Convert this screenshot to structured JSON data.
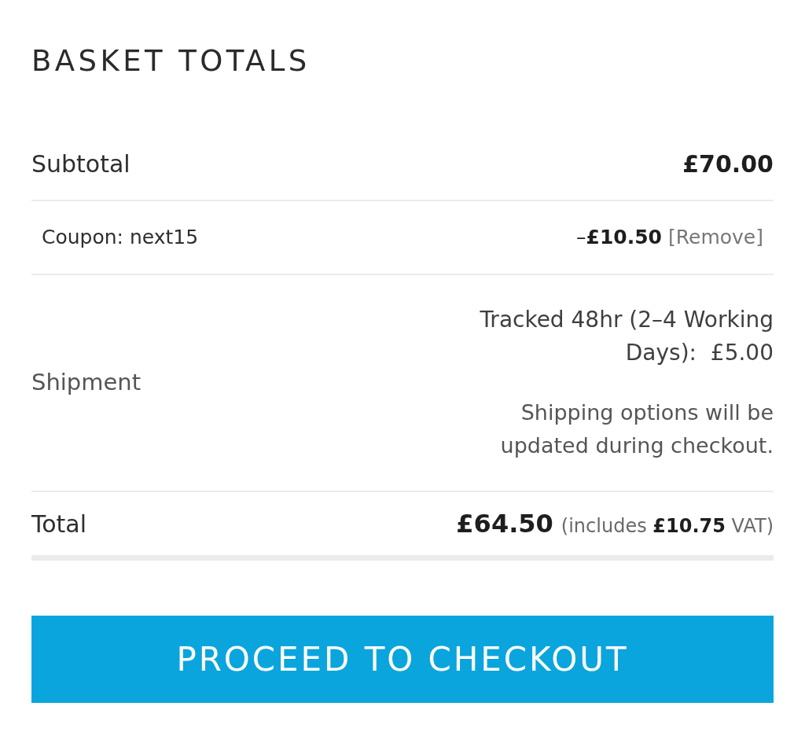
{
  "title": "BASKET TOTALS",
  "rows": [
    {
      "kind": "subtotal",
      "label": "Subtotal",
      "amount": "£70.00"
    },
    {
      "kind": "coupon",
      "label": "Coupon: next15",
      "amount": "–**£10.50**",
      "link": "[Remove]"
    },
    {
      "kind": "shipping",
      "label": "Shipment",
      "method": "Tracked 48hr (2–4 Working Days):  £5.00",
      "note": "Shipping options will be updated during checkout."
    },
    {
      "kind": "total",
      "label": "Total",
      "amount": "£64.50",
      "note": "(includes **£10.75** VAT)"
    }
  ],
  "button": {
    "label": "PROCEED TO CHECKOUT"
  }
}
